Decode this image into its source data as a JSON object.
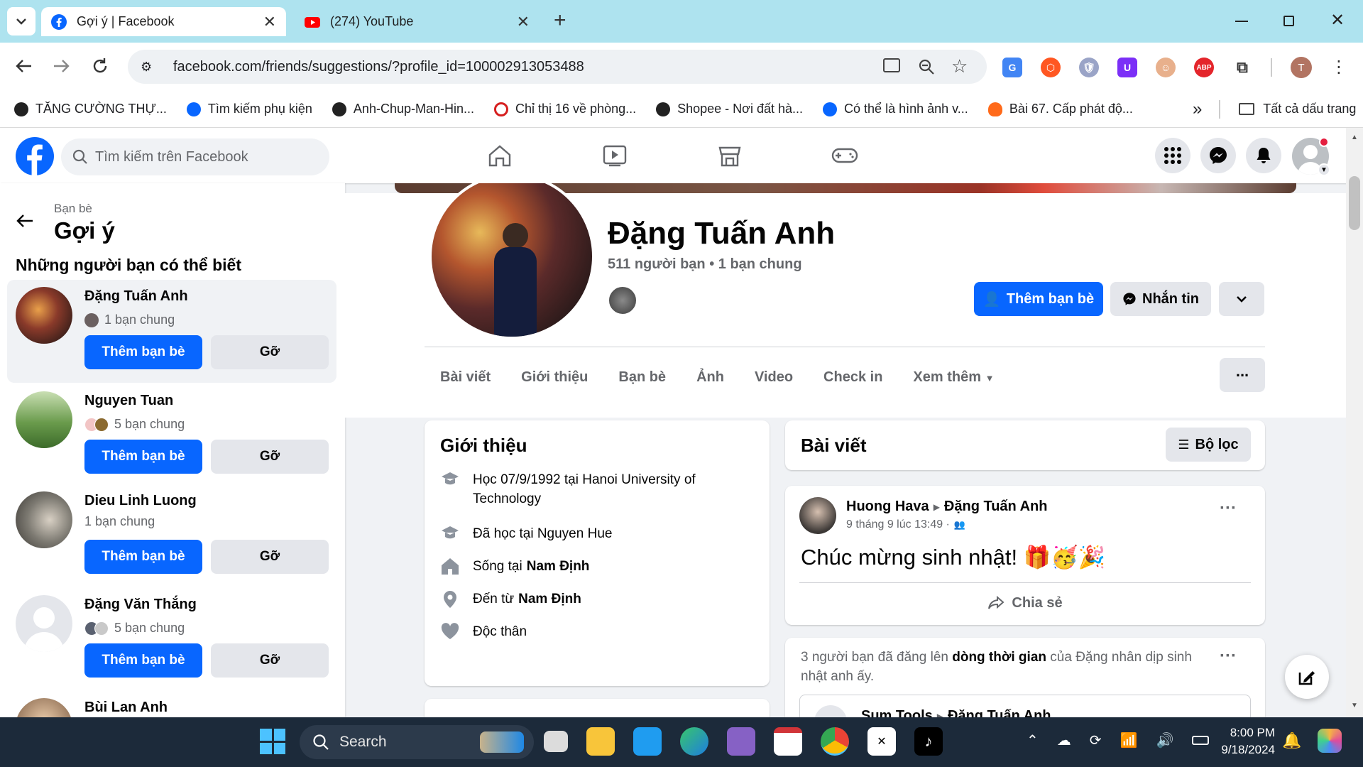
{
  "browser": {
    "tabs": [
      {
        "title": "Gợi ý | Facebook"
      },
      {
        "title": "(274) YouTube"
      }
    ],
    "new_tab": "+",
    "url": "facebook.com/friends/suggestions/?profile_id=100002913053488",
    "profile_initial": "T",
    "bookmarks": [
      "TĂNG CƯỜNG THỰ...",
      "Tìm kiếm phụ kiện",
      "Anh-Chup-Man-Hin...",
      "Chỉ thị 16 về phòng...",
      "Shopee - Nơi đất hà...",
      "Có thể là hình ảnh v...",
      "Bài 67. Cấp phát độ..."
    ],
    "bookmarks_more": "»",
    "all_bookmarks": "Tất cả dấu trang"
  },
  "fb": {
    "search_placeholder": "Tìm kiếm trên Facebook",
    "sidebar": {
      "breadcrumb": "Bạn bè",
      "title": "Gợi ý",
      "subtitle": "Những người bạn có thể biết",
      "add_label": "Thêm bạn bè",
      "remove_label": "Gỡ",
      "people": [
        {
          "name": "Đặng Tuấn Anh",
          "mutual": "1 bạn chung"
        },
        {
          "name": "Nguyen Tuan",
          "mutual": "5 bạn chung"
        },
        {
          "name": "Dieu Linh Luong",
          "mutual": "1 bạn chung"
        },
        {
          "name": "Đặng Văn Thắng",
          "mutual": "5 bạn chung"
        },
        {
          "name": "Bùi Lan Anh",
          "mutual": ""
        }
      ]
    },
    "profile": {
      "name": "Đặng Tuấn Anh",
      "friends_count": "511 người bạn",
      "mutual": "1 bạn chung",
      "add_friend": "Thêm bạn bè",
      "message": "Nhắn tin",
      "tabs": [
        "Bài viết",
        "Giới thiệu",
        "Bạn bè",
        "Ảnh",
        "Video",
        "Check in",
        "Xem thêm"
      ],
      "more": "..."
    },
    "intro": {
      "title": "Giới thiệu",
      "items": [
        {
          "icon": "graduation-cap-icon",
          "text": "Học 07/9/1992 tại Hanoi University of Technology"
        },
        {
          "icon": "graduation-cap-icon",
          "text": "Đã học tại Nguyen Hue"
        },
        {
          "icon": "home-icon",
          "prefix": "Sống tại ",
          "bold": "Nam Định"
        },
        {
          "icon": "location-pin-icon",
          "prefix": "Đến từ ",
          "bold": "Nam Định"
        },
        {
          "icon": "heart-icon",
          "text": "Độc thân"
        }
      ]
    },
    "posts": {
      "title": "Bài viết",
      "filter": "Bộ lọc",
      "post1": {
        "author": "Huong Hava",
        "target": "Đặng Tuấn Anh",
        "time": "9 tháng 9 lúc 13:49 ·",
        "content": "Chúc mừng sinh nhật! 🎁🥳🎉",
        "share": "Chia sẻ"
      },
      "post2": {
        "text_a": "3 người bạn đã đăng lên ",
        "text_b": "dòng thời gian",
        "text_c": " của Đặng nhân dịp sinh nhật anh ấy.",
        "sub_author": "Sum Tools",
        "sub_target": "Đặng Tuấn Anh"
      }
    }
  },
  "taskbar": {
    "search": "Search",
    "time": "8:00 PM",
    "date": "9/18/2024"
  },
  "colors": {
    "fb_blue": "#0866ff",
    "chrome_tabbar": "#aee3ef",
    "taskbar": "#1c2a3a"
  }
}
